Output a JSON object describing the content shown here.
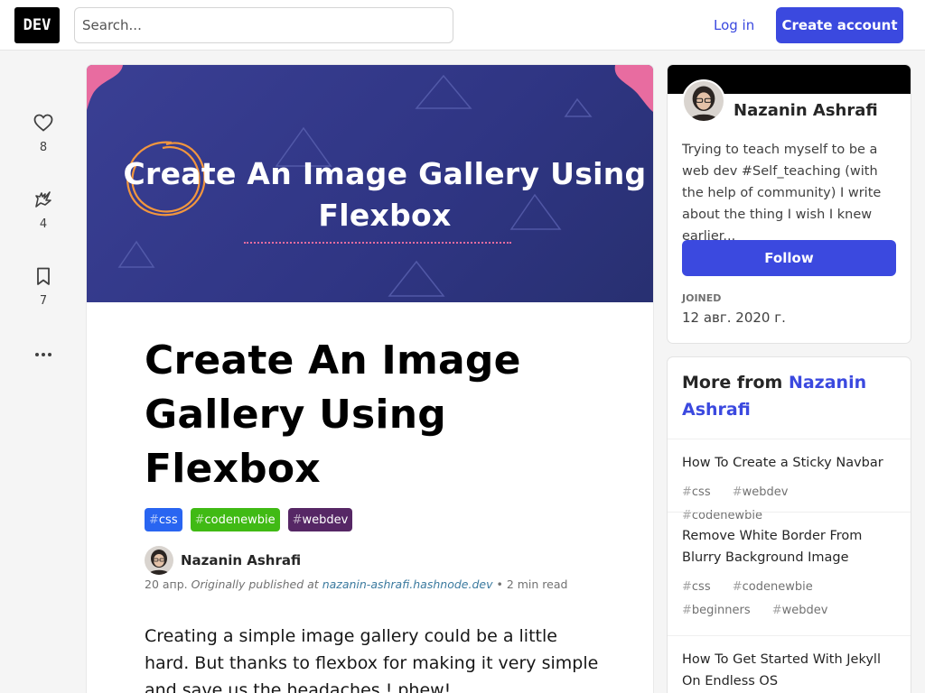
{
  "header": {
    "logo_text": "DEV",
    "search_placeholder": "Search...",
    "login_label": "Log in",
    "create_account_label": "Create account"
  },
  "reactions": {
    "likes": "8",
    "unicorns": "4",
    "bookmarks": "7"
  },
  "article": {
    "cover_title": "Create An Image Gallery Using Flexbox",
    "title": "Create An Image Gallery Using Flexbox",
    "tags": [
      {
        "name": "css",
        "color": "#2965f1"
      },
      {
        "name": "codenewbie",
        "color": "#40ba14"
      },
      {
        "name": "webdev",
        "color": "#562765"
      }
    ],
    "author_name": "Nazanin Ashrafi",
    "date": "20 апр.",
    "originally_published": "Originally published at",
    "original_url": "nazanin-ashrafi.hashnode.dev",
    "read_time": "2 min read",
    "body_intro": "Creating a simple image gallery could be a little hard. But thanks to flexbox for making it very simple and save us the headaches ! phew!"
  },
  "profile": {
    "name": "Nazanin Ashrafi",
    "bio": "Trying to teach myself to be a web dev #Self_teaching (with the help of community) I write about the thing I wish I knew earlier...",
    "follow_label": "Follow",
    "joined_label": "Joined",
    "joined_value": "12 авг. 2020 г."
  },
  "more_from": {
    "prefix": "More from",
    "author": "Nazanin Ashrafi",
    "items": [
      {
        "title": "How To Create a Sticky Navbar",
        "tags": [
          "css",
          "webdev",
          "codenewbie"
        ]
      },
      {
        "title": "Remove White Border From Blurry Background Image",
        "tags": [
          "css",
          "codenewbie",
          "beginners",
          "webdev"
        ]
      },
      {
        "title": "How To Get Started With Jekyll On Endless OS",
        "tags": []
      }
    ]
  },
  "colors": {
    "accent": "#3b49df",
    "cover_bg": "#2f3583",
    "cover_accent": "#e86ca0"
  }
}
